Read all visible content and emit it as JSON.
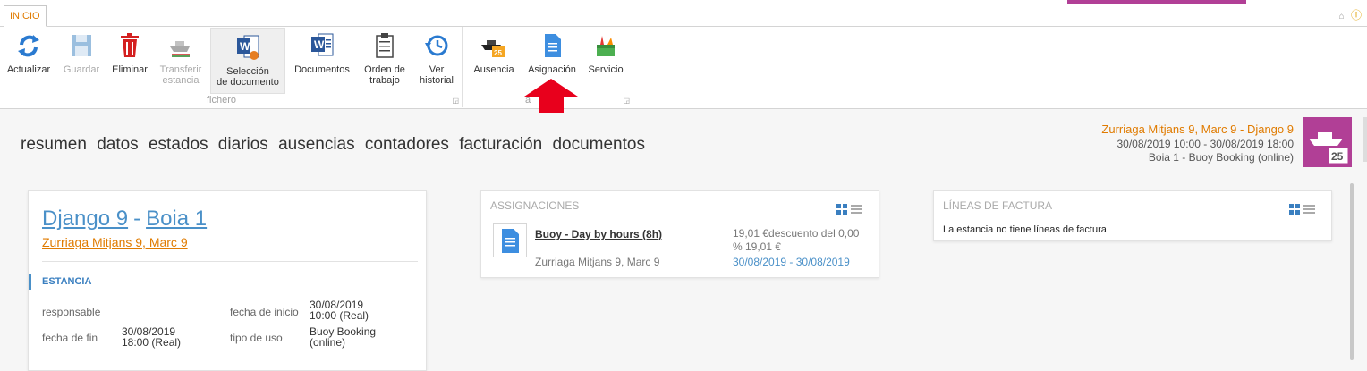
{
  "ribbon": {
    "tab": "INICIO",
    "groups": [
      {
        "label": "fichero"
      },
      {
        "label": "a"
      }
    ],
    "buttons": {
      "refresh": "Actualizar",
      "save": "Guardar",
      "delete": "Eliminar",
      "transfer_1": "Transferir",
      "transfer_2": "estancia",
      "select_doc_1": "Selección",
      "select_doc_2": "de documento",
      "documents": "Documentos",
      "work_order_1": "Orden de",
      "work_order_2": "trabajo",
      "history_1": "Ver",
      "history_2": "historial",
      "absence": "Ausencia",
      "assignment": "Asignación",
      "service": "Servicio"
    }
  },
  "nav": {
    "items": [
      "resumen",
      "datos",
      "estados",
      "diarios",
      "ausencias",
      "contadores",
      "facturación",
      "documentos"
    ]
  },
  "header": {
    "title": "Zurriaga Mitjans 9, Marc 9 - Django 9",
    "dates": "30/08/2019 10:00 - 30/08/2019 18:00",
    "resource": "Boia 1 - Buoy Booking (online)",
    "tile_number": "25"
  },
  "main": {
    "title_left": "Django 9",
    "title_sep": "-",
    "title_right": "Boia 1",
    "client": "Zurriaga Mitjans 9, Marc 9",
    "section": "ESTANCIA",
    "labels": {
      "responsible": "responsable",
      "end_date": "fecha de fin",
      "start_date": "fecha de inicio",
      "use_type": "tipo de uso"
    },
    "values": {
      "end_date_1": "30/08/2019",
      "end_date_2": "18:00 (Real)",
      "start_date_1": "30/08/2019",
      "start_date_2": "10:00 (Real)",
      "use_type_1": "Buoy Booking",
      "use_type_2": "(online)"
    }
  },
  "assignments": {
    "title": "ASSIGNACIONES",
    "item": {
      "name": "Buoy - Day by hours (8h)",
      "client": "Zurriaga Mitjans 9, Marc 9",
      "price_1": "19,01 €descuento del 0,00",
      "price_2": "% 19,01 €",
      "dates": "30/08/2019 - 30/08/2019"
    }
  },
  "invoice": {
    "title": "LÍNEAS DE FACTURA",
    "empty": "La estancia no tiene líneas de factura"
  },
  "colors": {
    "accent_orange": "#e07b00",
    "accent_blue": "#4a90c8",
    "purple": "#b13f96",
    "arrow_red": "#e8001c"
  }
}
